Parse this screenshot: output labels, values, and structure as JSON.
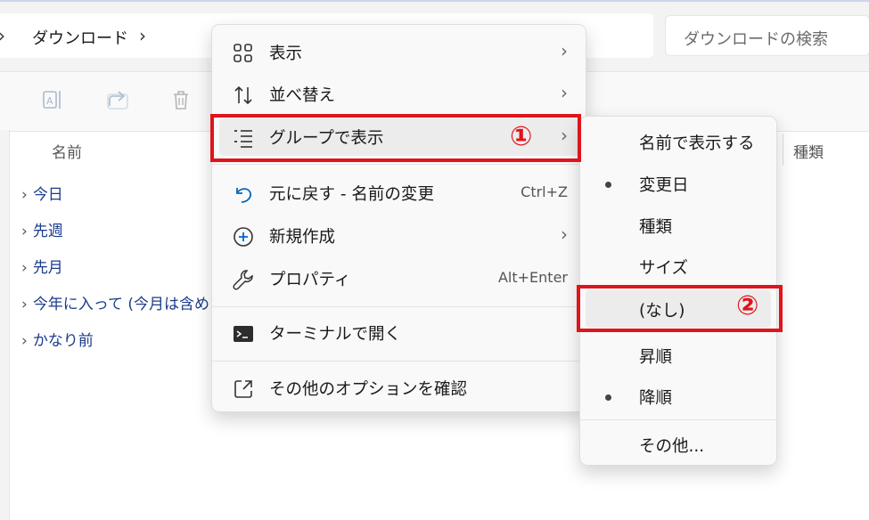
{
  "address": {
    "crumb": "ダウンロード",
    "search_placeholder": "ダウンロードの検索"
  },
  "columns": {
    "name": "名前",
    "kind": "種類"
  },
  "groups": [
    "今日",
    "先週",
    "先月",
    "今年に入って (今月は含め",
    "かなり前"
  ],
  "context_menu": {
    "items": [
      {
        "label": "表示",
        "icon": "grid-icon",
        "submenu": true
      },
      {
        "label": "並べ替え",
        "icon": "sort-icon",
        "submenu": true
      },
      {
        "label": "グループで表示",
        "icon": "group-list-icon",
        "submenu": true,
        "highlighted": true
      },
      {
        "label": "元に戻す - 名前の変更",
        "icon": "undo-icon",
        "shortcut": "Ctrl+Z"
      },
      {
        "label": "新規作成",
        "icon": "new-icon",
        "submenu": true
      },
      {
        "label": "プロパティ",
        "icon": "wrench-icon",
        "shortcut": "Alt+Enter"
      },
      {
        "label": "ターミナルで開く",
        "icon": "terminal-icon"
      },
      {
        "label": "その他のオプションを確認",
        "icon": "expand-icon"
      }
    ]
  },
  "group_submenu": {
    "items": [
      {
        "label": "名前で表示する",
        "checked": false
      },
      {
        "label": "変更日",
        "checked": true
      },
      {
        "label": "種類",
        "checked": false
      },
      {
        "label": "サイズ",
        "checked": false
      },
      {
        "label": "(なし)",
        "checked": false,
        "highlighted": true
      },
      {
        "label": "昇順",
        "checked": false
      },
      {
        "label": "降順",
        "checked": true
      },
      {
        "label": "その他...",
        "checked": false
      }
    ]
  },
  "annotations": {
    "step1": "①",
    "step2": "②"
  },
  "colors": {
    "annotation_red": "#e0141b",
    "group_text": "#1b3c8c",
    "accent_blue": "#0067c0"
  }
}
